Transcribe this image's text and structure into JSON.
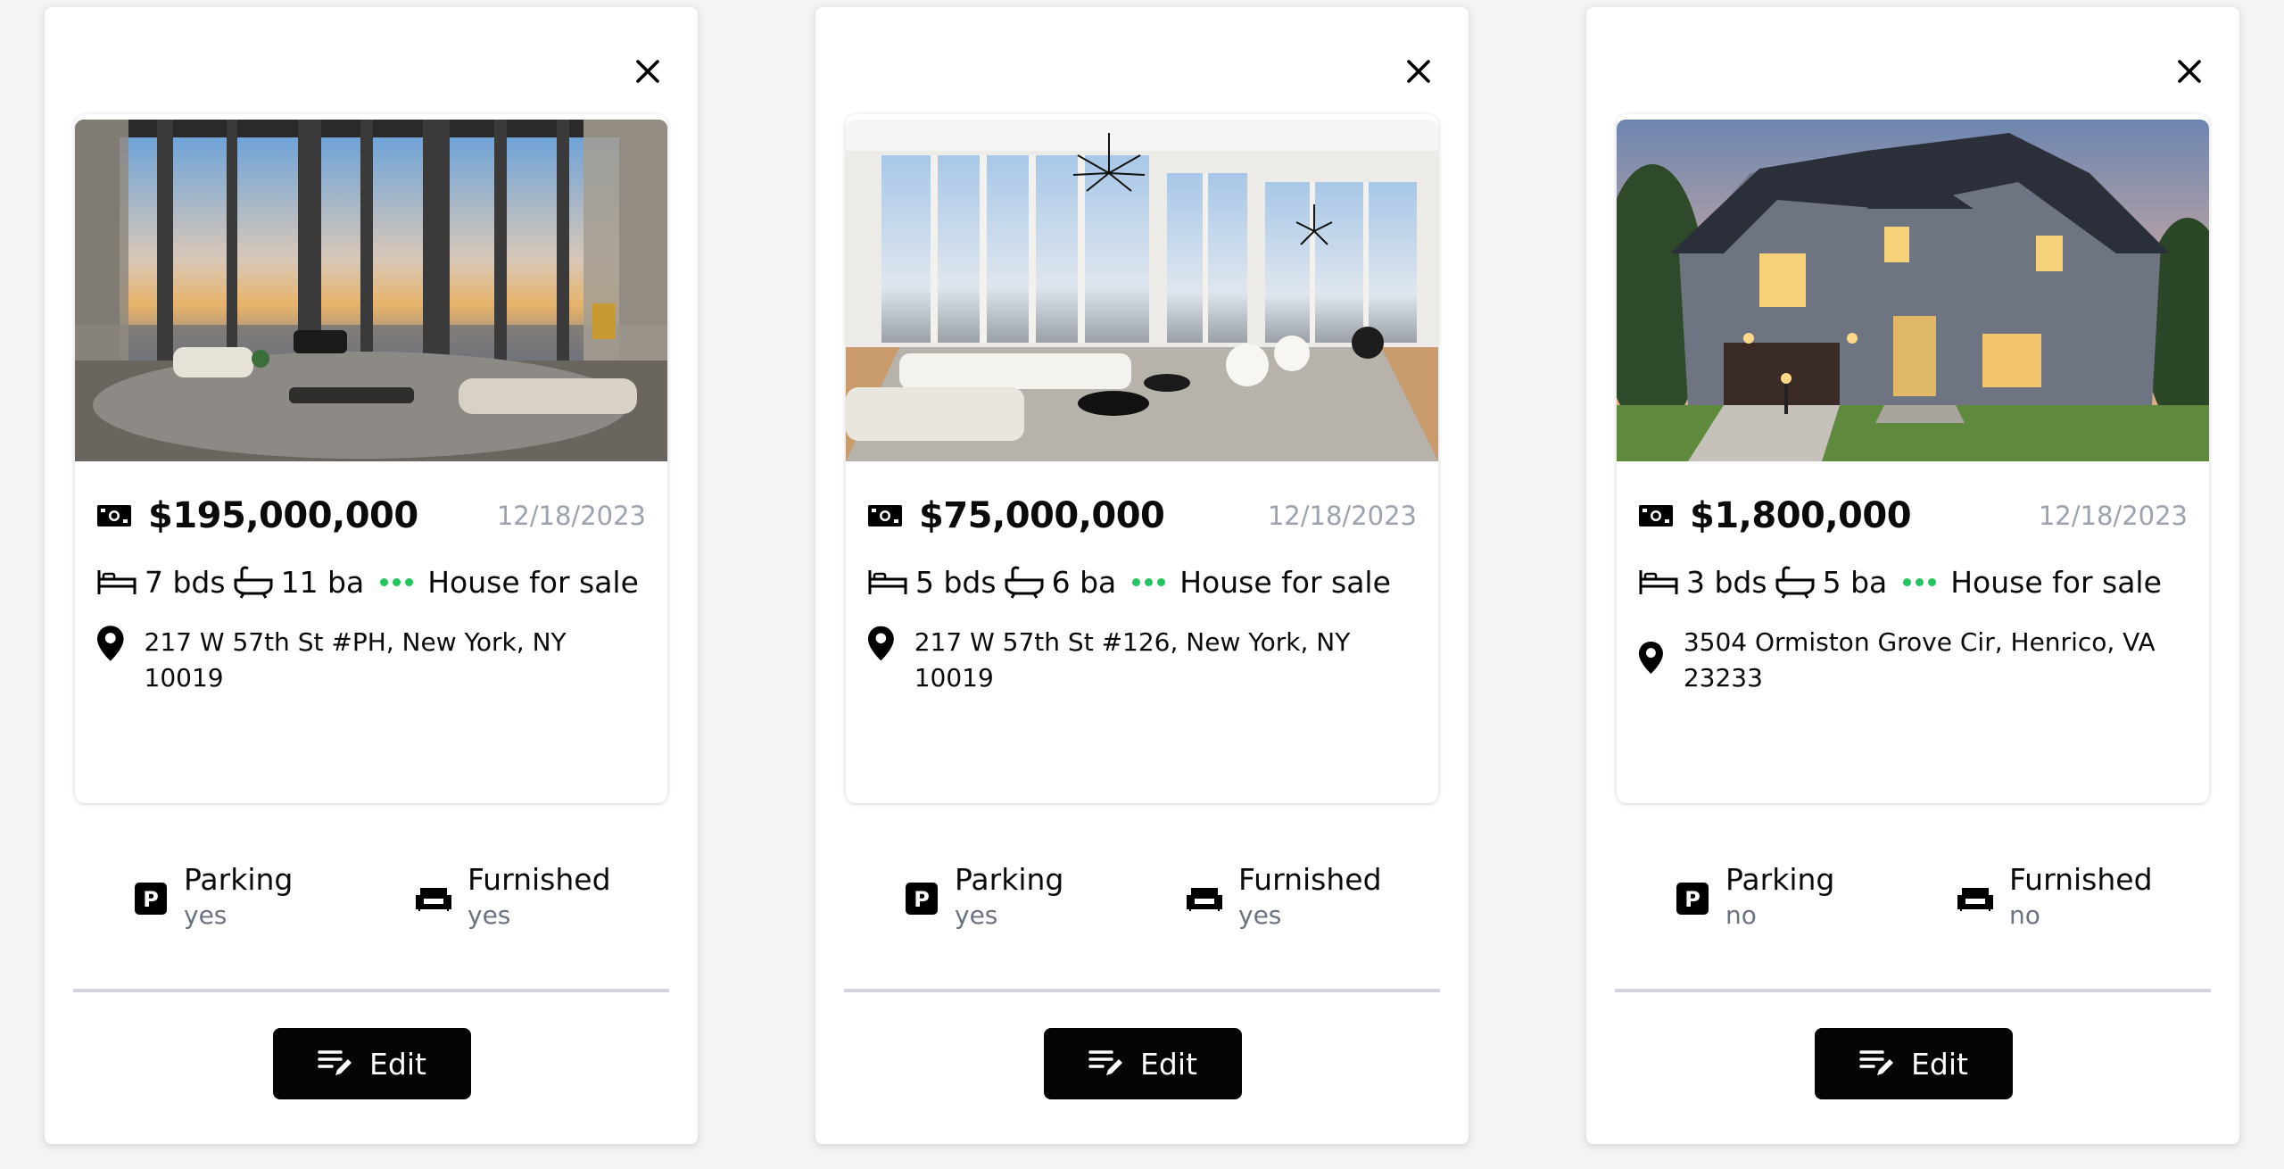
{
  "colors": {
    "accent_dots": "#22c55e",
    "muted_text": "#9ca3af",
    "button_bg": "#050505"
  },
  "icons": {
    "close": "close-icon",
    "price": "banknote-icon",
    "beds": "bed-icon",
    "baths": "bathtub-icon",
    "status": "status-dots-icon",
    "address": "map-pin-icon",
    "parking": "parking-icon",
    "furnished": "sofa-icon",
    "edit": "edit-icon"
  },
  "cards": [
    {
      "price": "$195,000,000",
      "date": "12/18/2023",
      "beds": "7 bds",
      "baths": "11 ba",
      "status": "House for sale",
      "address": "217 W 57th St #PH, New York, NY 10019",
      "photo": "Penthouse living room with floor-to-ceiling windows over a city skyline",
      "parking_label": "Parking",
      "parking_value": "yes",
      "furnished_label": "Furnished",
      "furnished_value": "yes",
      "edit_label": "Edit"
    },
    {
      "price": "$75,000,000",
      "date": "12/18/2023",
      "beds": "5 bds",
      "baths": "6 ba",
      "status": "House for sale",
      "address": "217 W 57th St #126, New York, NY 10019",
      "photo": "Bright white living room with chandeliers and city views",
      "parking_label": "Parking",
      "parking_value": "yes",
      "furnished_label": "Furnished",
      "furnished_value": "yes",
      "edit_label": "Edit"
    },
    {
      "price": "$1,800,000",
      "date": "12/18/2023",
      "beds": "3 bds",
      "baths": "5 ba",
      "status": "House for sale",
      "address": "3504 Ormiston Grove Cir, Henrico, VA 23233",
      "photo": "Gray two-story house with lit windows at dusk",
      "parking_label": "Parking",
      "parking_value": "no",
      "furnished_label": "Furnished",
      "furnished_value": "no",
      "edit_label": "Edit"
    }
  ]
}
